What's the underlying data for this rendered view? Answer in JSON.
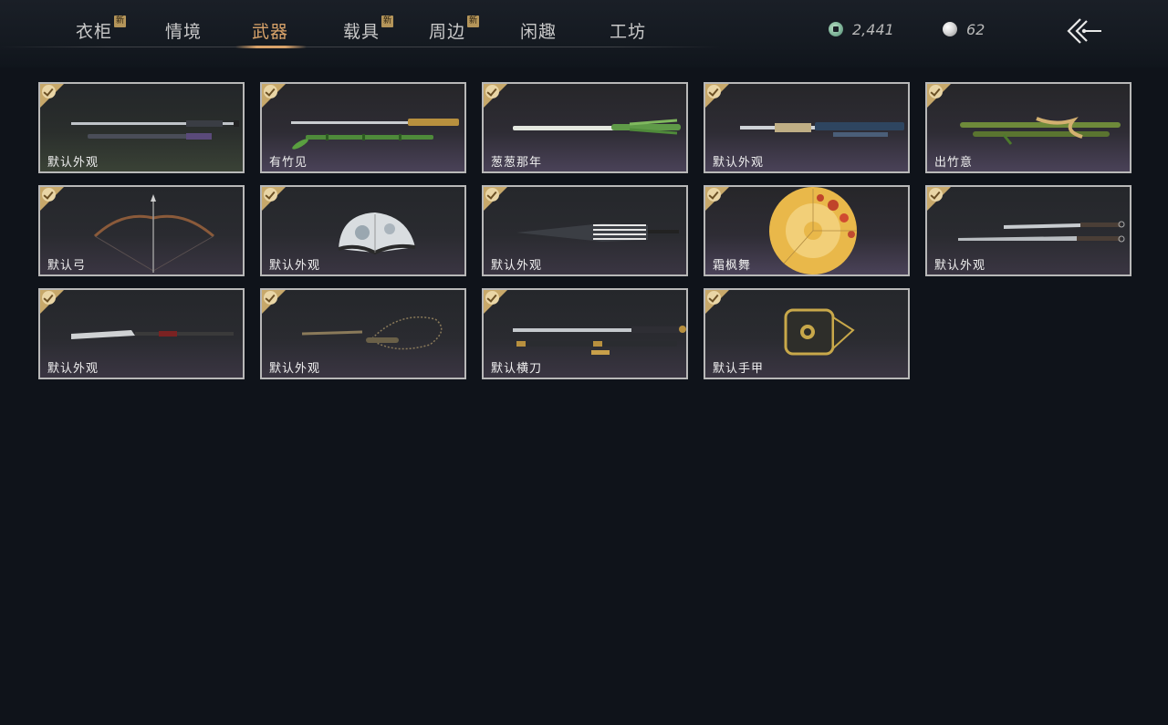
{
  "tabs": [
    {
      "label": "衣柜",
      "badge": "新"
    },
    {
      "label": "情境"
    },
    {
      "label": "武器"
    },
    {
      "label": "载具",
      "badge": "新"
    },
    {
      "label": "周边",
      "badge": "新"
    },
    {
      "label": "闲趣"
    },
    {
      "label": "工坊"
    }
  ],
  "active_tab": "武器",
  "currency": {
    "coins": "2,441",
    "pearls": "62"
  },
  "items": [
    {
      "label": "默认外观",
      "icon": "twin-blades-icon"
    },
    {
      "label": "有竹见",
      "icon": "bamboo-sword-icon"
    },
    {
      "label": "葱葱那年",
      "icon": "scallion-sword-icon"
    },
    {
      "label": "默认外观",
      "icon": "ornate-sword-icon"
    },
    {
      "label": "出竹意",
      "icon": "bamboo-blade-icon"
    },
    {
      "label": "默认弓",
      "icon": "bow-icon"
    },
    {
      "label": "默认外观",
      "icon": "folding-fan-icon"
    },
    {
      "label": "默认外观",
      "icon": "umbrella-closed-icon"
    },
    {
      "label": "霜枫舞",
      "icon": "maple-umbrella-icon"
    },
    {
      "label": "默认外观",
      "icon": "dual-swords-icon"
    },
    {
      "label": "默认外观",
      "icon": "glaive-icon"
    },
    {
      "label": "默认外观",
      "icon": "chain-whip-icon"
    },
    {
      "label": "默认横刀",
      "icon": "hengdao-icon"
    },
    {
      "label": "默认手甲",
      "icon": "gauntlet-icon"
    }
  ],
  "colors": {
    "accent": "#d9a36a",
    "badge": "#b4955a",
    "check": "#c7a86a",
    "background": "#0f131a"
  }
}
